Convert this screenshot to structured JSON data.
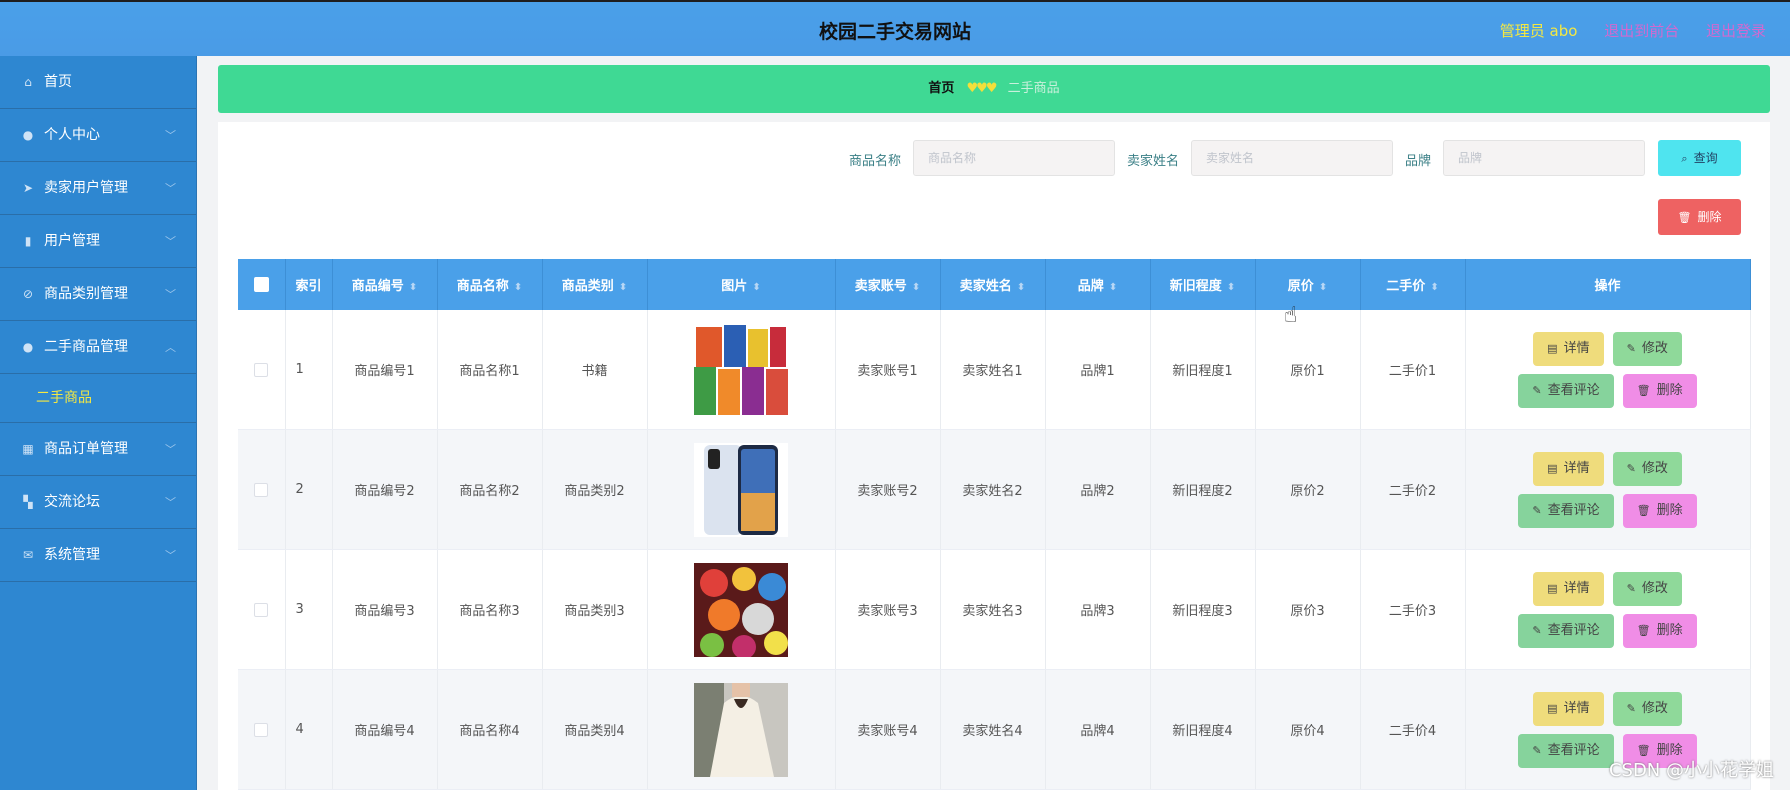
{
  "header": {
    "title": "校园二手交易网站",
    "admin": "管理员 abo",
    "links": [
      "退出到前台",
      "退出登录"
    ]
  },
  "sidebar": {
    "items": [
      {
        "label": "首页",
        "icon": "home-icon",
        "expanded": false
      },
      {
        "label": "个人中心",
        "icon": "user-icon",
        "expanded": false
      },
      {
        "label": "卖家用户管理",
        "icon": "send-icon",
        "expanded": false
      },
      {
        "label": "用户管理",
        "icon": "bar-chart-icon",
        "expanded": false
      },
      {
        "label": "商品类别管理",
        "icon": "bell-off-icon",
        "expanded": false
      },
      {
        "label": "二手商品管理",
        "icon": "user-icon",
        "expanded": true
      },
      {
        "label": "商品订单管理",
        "icon": "grid-icon",
        "expanded": false
      },
      {
        "label": "交流论坛",
        "icon": "apps-icon",
        "expanded": false
      },
      {
        "label": "系统管理",
        "icon": "mail-icon",
        "expanded": false
      }
    ],
    "submenu": {
      "label": "二手商品",
      "parent": "二手商品管理"
    }
  },
  "breadcrumb": {
    "home": "首页",
    "separator": "♥♥♥",
    "current": "二手商品"
  },
  "search": {
    "name_label": "商品名称",
    "name_placeholder": "商品名称",
    "seller_label": "卖家姓名",
    "seller_placeholder": "卖家姓名",
    "brand_label": "品牌",
    "brand_placeholder": "品牌",
    "search_button": "查询",
    "delete_button": "删除"
  },
  "table": {
    "columns": [
      "索引",
      "商品编号",
      "商品名称",
      "商品类别",
      "图片",
      "卖家账号",
      "卖家姓名",
      "品牌",
      "新旧程度",
      "原价",
      "二手价",
      "操作"
    ],
    "rows": [
      {
        "index": "1",
        "code": "商品编号1",
        "name": "商品名称1",
        "category": "书籍",
        "image": "snacks-product-image",
        "seller_account": "卖家账号1",
        "seller_name": "卖家姓名1",
        "brand": "品牌1",
        "condition": "新旧程度1",
        "price": "原价1",
        "used_price": "二手价1"
      },
      {
        "index": "2",
        "code": "商品编号2",
        "name": "商品名称2",
        "category": "商品类别2",
        "image": "phone-product-image",
        "seller_account": "卖家账号2",
        "seller_name": "卖家姓名2",
        "brand": "品牌2",
        "condition": "新旧程度2",
        "price": "原价2",
        "used_price": "二手价2"
      },
      {
        "index": "3",
        "code": "商品编号3",
        "name": "商品名称3",
        "category": "商品类别3",
        "image": "candy-product-image",
        "seller_account": "卖家账号3",
        "seller_name": "卖家姓名3",
        "brand": "品牌3",
        "condition": "新旧程度3",
        "price": "原价3",
        "used_price": "二手价3"
      },
      {
        "index": "4",
        "code": "商品编号4",
        "name": "商品名称4",
        "category": "商品类别4",
        "image": "blouse-product-image",
        "seller_account": "卖家账号4",
        "seller_name": "卖家姓名4",
        "brand": "品牌4",
        "condition": "新旧程度4",
        "price": "原价4",
        "used_price": "二手价4"
      }
    ],
    "actions": {
      "detail": "详情",
      "edit": "修改",
      "review": "查看评论",
      "delete": "删除"
    }
  },
  "watermark": "CSDN @小小花学姐",
  "colors": {
    "header": "#4a9be6",
    "sidebar": "#2e87d1",
    "breadcrumb": "#3fd994",
    "accent_yellow": "#f4e842"
  }
}
